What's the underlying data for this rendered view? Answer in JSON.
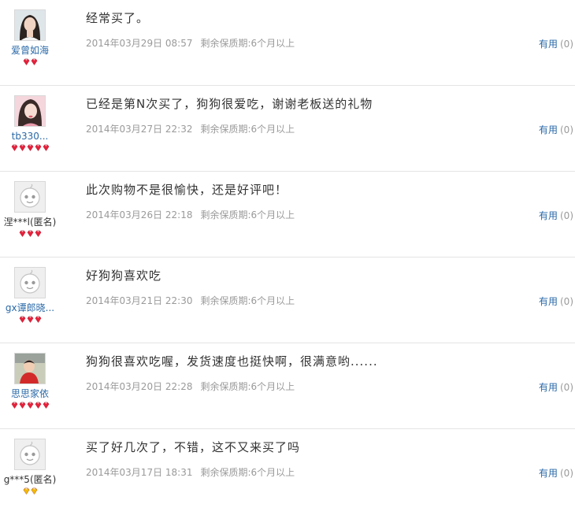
{
  "colors": {
    "link_blue": "#2a69a8",
    "meta_gray": "#9a9a9a",
    "red_gem": "#e8203b",
    "gold_gem": "#f3b900"
  },
  "reviews": [
    {
      "avatar": "photo-woman-dark-hair",
      "nickname": "爱曾如海",
      "anonymous": false,
      "level": {
        "count": 2,
        "type": "red"
      },
      "content": "经常买了。",
      "date": "2014年03月29日 08:57",
      "expiry": "剩余保质期:6个月以上",
      "useful_label": "有用",
      "useful_count": "(0)"
    },
    {
      "avatar": "photo-woman-pink",
      "nickname": "tb330...",
      "anonymous": false,
      "level": {
        "count": 5,
        "type": "red"
      },
      "content": "已经是第N次买了，狗狗很爱吃，谢谢老板送的礼物",
      "date": "2014年03月27日 22:32",
      "expiry": "剩余保质期:6个月以上",
      "useful_label": "有用",
      "useful_count": "(0)"
    },
    {
      "avatar": "default-face",
      "nickname": "涅***l(匿名)",
      "anonymous": true,
      "level": {
        "count": 3,
        "type": "red"
      },
      "content": "此次购物不是很愉快，还是好评吧！",
      "date": "2014年03月26日 22:18",
      "expiry": "剩余保质期:6个月以上",
      "useful_label": "有用",
      "useful_count": "(0)"
    },
    {
      "avatar": "default-face",
      "nickname": "gx谭郎晓...",
      "anonymous": false,
      "level": {
        "count": 3,
        "type": "red"
      },
      "content": "好狗狗喜欢吃",
      "date": "2014年03月21日 22:30",
      "expiry": "剩余保质期:6个月以上",
      "useful_label": "有用",
      "useful_count": "(0)"
    },
    {
      "avatar": "photo-child-red",
      "nickname": "思思家依",
      "anonymous": false,
      "level": {
        "count": 5,
        "type": "red"
      },
      "content": "狗狗很喜欢吃喔，发货速度也挺快啊，很满意哟......",
      "date": "2014年03月20日 22:28",
      "expiry": "剩余保质期:6个月以上",
      "useful_label": "有用",
      "useful_count": "(0)"
    },
    {
      "avatar": "default-face",
      "nickname": "g***5(匿名)",
      "anonymous": true,
      "level": {
        "count": 2,
        "type": "gold"
      },
      "content": "买了好几次了，不错，这不又来买了吗",
      "date": "2014年03月17日 18:31",
      "expiry": "剩余保质期:6个月以上",
      "useful_label": "有用",
      "useful_count": "(0)"
    }
  ]
}
